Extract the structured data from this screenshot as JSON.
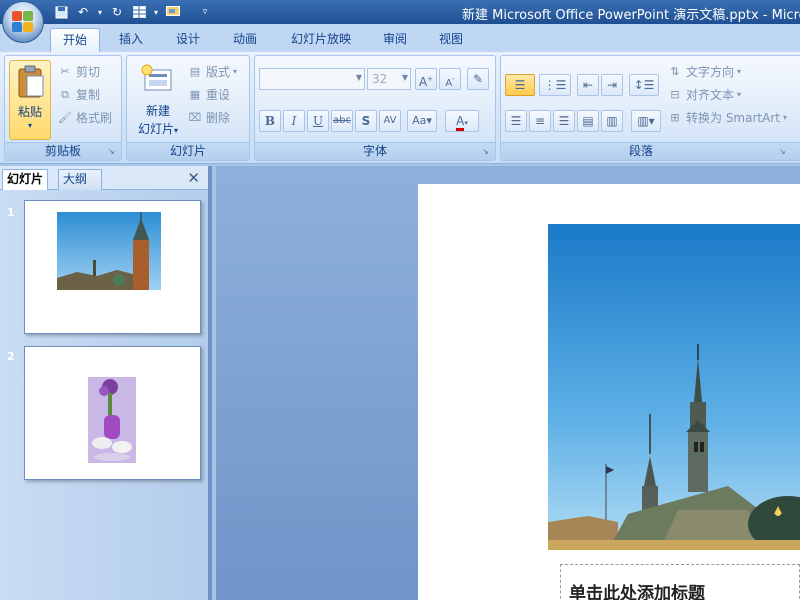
{
  "window": {
    "title": "新建 Microsoft Office PowerPoint 演示文稿.pptx - Micro"
  },
  "ribbon_tabs": [
    {
      "label": "开始",
      "active": true
    },
    {
      "label": "插入"
    },
    {
      "label": "设计"
    },
    {
      "label": "动画"
    },
    {
      "label": "幻灯片放映"
    },
    {
      "label": "审阅"
    },
    {
      "label": "视图"
    }
  ],
  "clipboard": {
    "group_label": "剪贴板",
    "paste": "粘贴",
    "cut": "剪切",
    "copy": "复制",
    "format_painter": "格式刷"
  },
  "slides_group": {
    "group_label": "幻灯片",
    "new_slide_line1": "新建",
    "new_slide_line2": "幻灯片",
    "layout": "版式",
    "reset": "重设",
    "delete": "删除"
  },
  "font": {
    "group_label": "字体",
    "font_name": "",
    "font_size": "32"
  },
  "paragraph": {
    "group_label": "段落",
    "text_direction": "文字方向",
    "align_text": "对齐文本",
    "convert_smartart": "转换为 SmartArt"
  },
  "panel": {
    "tab_slides": "幻灯片",
    "tab_outline": "大纲",
    "slides": [
      {
        "number": "1"
      },
      {
        "number": "2"
      }
    ]
  },
  "slide": {
    "title_placeholder": "单击此处添加标题"
  },
  "colors": {
    "accent": "#f6c34a",
    "ribbon": "#d5e5f8",
    "titlebar": "#2a5ca0"
  }
}
